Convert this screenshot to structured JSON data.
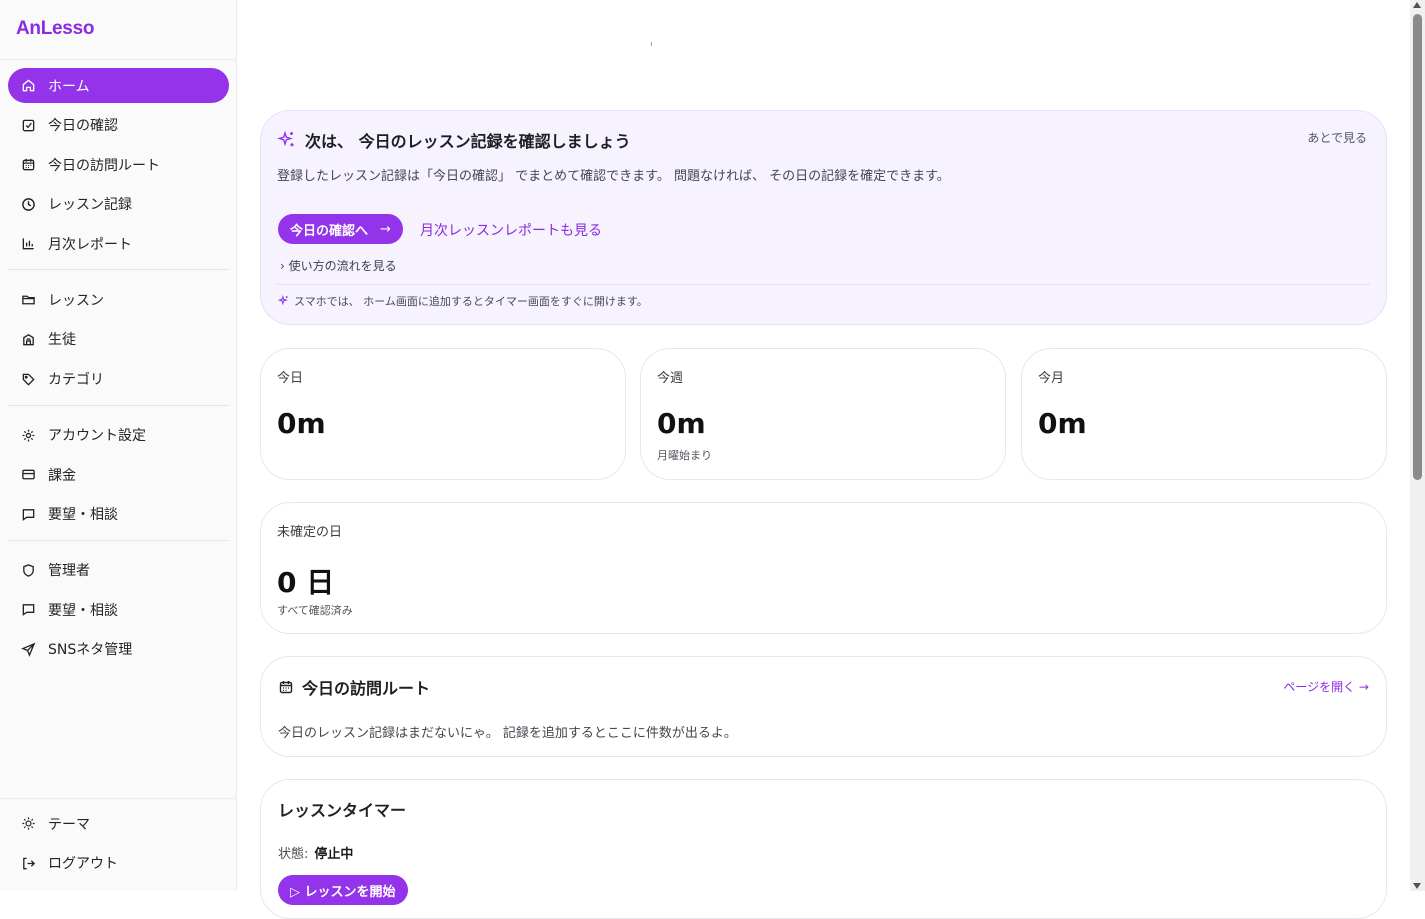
{
  "app": {
    "brand": "AnLesso"
  },
  "sidebar": {
    "items": [
      {
        "label": "ホーム",
        "icon": "home-icon",
        "active": true
      },
      {
        "label": "今日の確認",
        "icon": "checkbox-icon"
      },
      {
        "label": "今日の訪問ルート",
        "icon": "calendar-icon"
      },
      {
        "label": "レッスン記録",
        "icon": "clock-icon"
      },
      {
        "label": "月次レポート",
        "icon": "bar-chart-icon"
      },
      {
        "label": "レッスン",
        "icon": "folder-icon"
      },
      {
        "label": "生徒",
        "icon": "students-icon"
      },
      {
        "label": "カテゴリ",
        "icon": "tag-icon"
      },
      {
        "label": "アカウント設定",
        "icon": "gear-icon"
      },
      {
        "label": "課金",
        "icon": "credit-card-icon"
      },
      {
        "label": "要望・相談",
        "icon": "message-icon"
      },
      {
        "label": "管理者",
        "icon": "shield-icon"
      },
      {
        "label": "要望・相談",
        "icon": "message-icon"
      },
      {
        "label": "SNSネタ管理",
        "icon": "send-icon"
      }
    ],
    "bottom": [
      {
        "label": "テーマ",
        "icon": "sun-icon"
      },
      {
        "label": "ログアウト",
        "icon": "logout-icon"
      }
    ]
  },
  "banner": {
    "title": "次は、 今日のレッスン記録を確認しましょう",
    "later": "あとで見る",
    "description": "登録したレッスン記録は「今日の確認」 でまとめて確認できます。 問題なければ、 その日の記録を確定できます。",
    "primary_button": "今日の確認へ",
    "primary_arrow": "→",
    "monthly_link": "月次レッスンレポートも見る",
    "flow_link": "› 使い方の流れを見る",
    "tip": "スマホでは、 ホーム画面に追加するとタイマー画面をすぐに開けます。"
  },
  "stats": [
    {
      "label": "今日",
      "value": "0m",
      "sub": ""
    },
    {
      "label": "今週",
      "value": "0m",
      "sub": "月曜始まり"
    },
    {
      "label": "今月",
      "value": "0m",
      "sub": ""
    }
  ],
  "pending": {
    "label": "未確定の日",
    "value": "0 日",
    "sub": "すべて確認済み"
  },
  "route": {
    "title": "今日の訪問ルート",
    "open_link": "ページを開く →",
    "description": "今日のレッスン記録はまだないにゃ。 記録を追加するとここに件数が出るよ。"
  },
  "timer": {
    "title": "レッスンタイマー",
    "state_label": "状態:",
    "state_value": "停止中",
    "start_button": "▷ レッスンを開始"
  },
  "colors": {
    "accent": "#9333ea",
    "banner_bg": "#f6f2fe"
  }
}
